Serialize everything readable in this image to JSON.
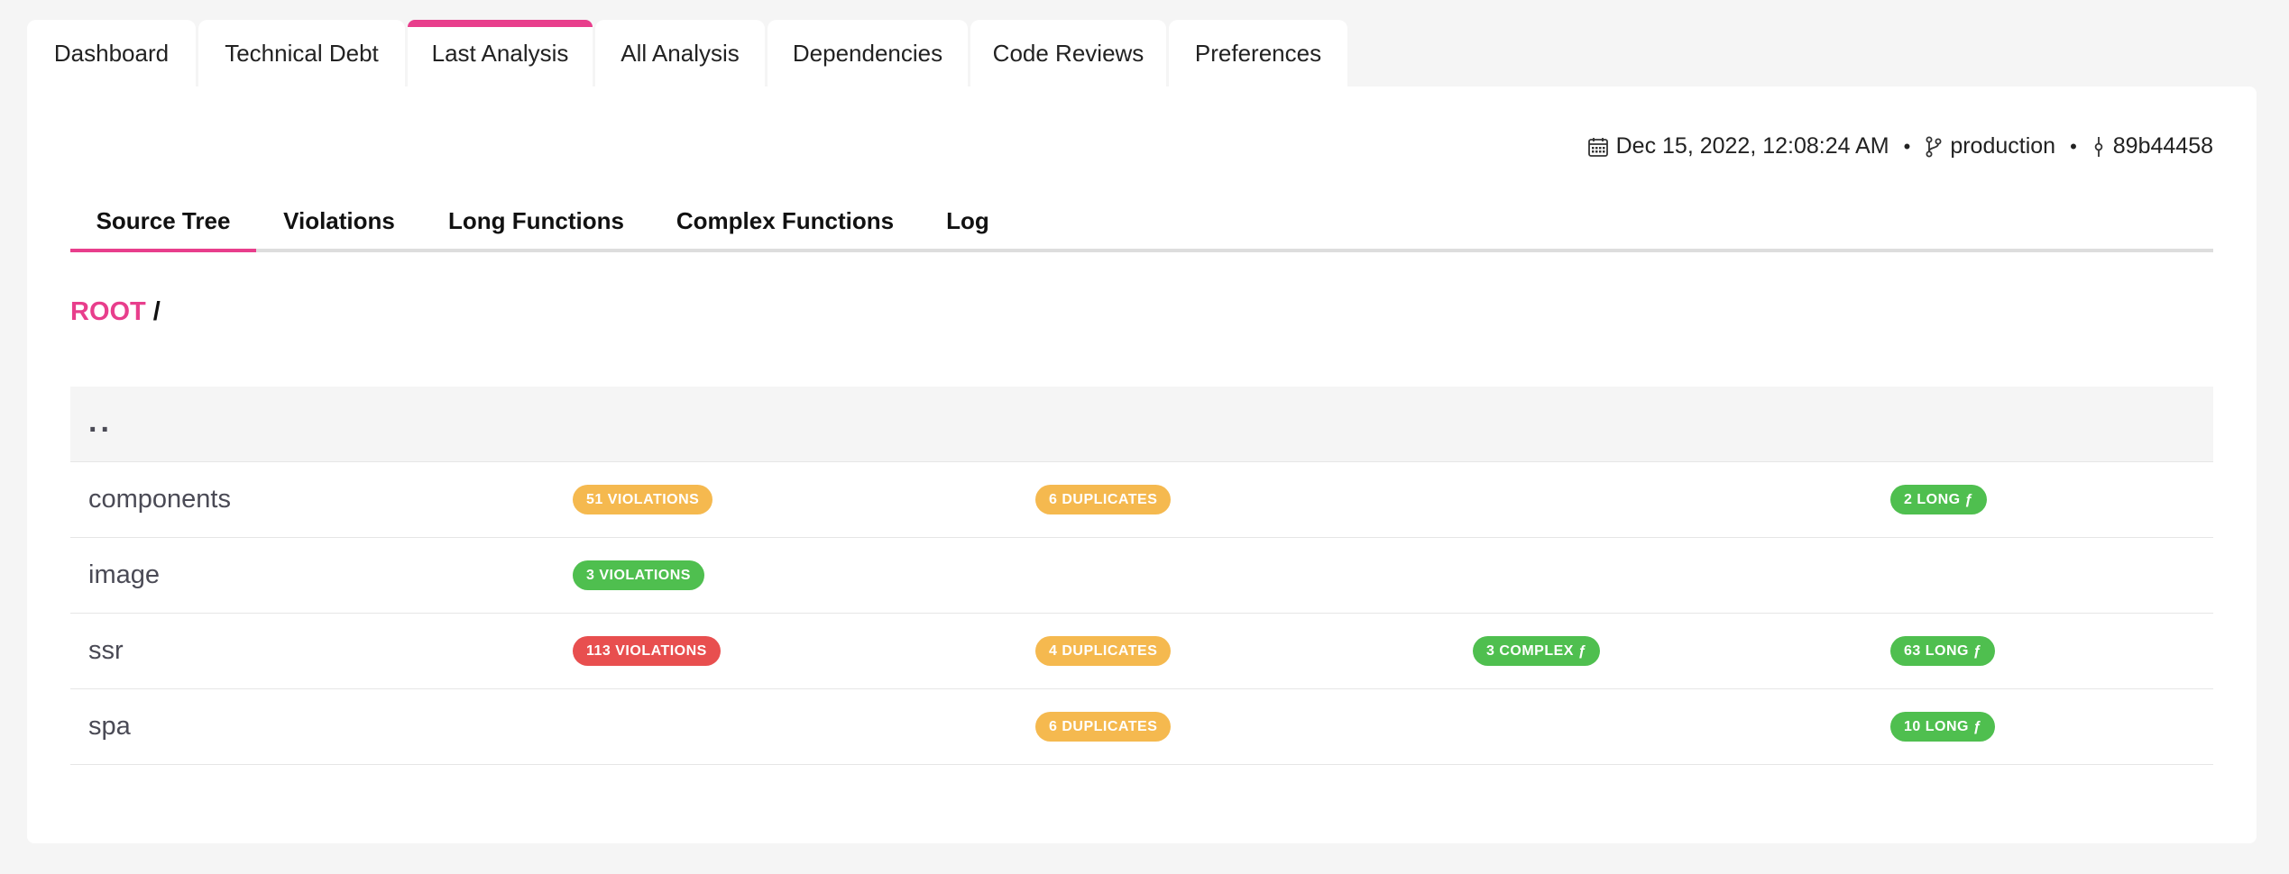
{
  "top_tabs": [
    {
      "label": "Dashboard",
      "active": false
    },
    {
      "label": "Technical Debt",
      "active": false
    },
    {
      "label": "Last Analysis",
      "active": true
    },
    {
      "label": "All Analysis",
      "active": false
    },
    {
      "label": "Dependencies",
      "active": false
    },
    {
      "label": "Code Reviews",
      "active": false
    },
    {
      "label": "Preferences",
      "active": false
    }
  ],
  "meta": {
    "date": "Dec 15, 2022, 12:08:24 AM",
    "branch": "production",
    "commit": "89b44458",
    "separator": "•"
  },
  "sub_tabs": [
    {
      "label": "Source Tree",
      "active": true
    },
    {
      "label": "Violations",
      "active": false
    },
    {
      "label": "Long Functions",
      "active": false
    },
    {
      "label": "Complex Functions",
      "active": false
    },
    {
      "label": "Log",
      "active": false
    }
  ],
  "breadcrumb": {
    "root": "ROOT",
    "separator": "/"
  },
  "tree": {
    "parent_label": "..",
    "rows": [
      {
        "name": "components",
        "violations": "51 VIOLATIONS",
        "duplicates": "6 DUPLICATES",
        "complex": "",
        "long": "2 LONG ƒ"
      },
      {
        "name": "image",
        "violations": "3 VIOLATIONS",
        "duplicates": "",
        "complex": "",
        "long": ""
      },
      {
        "name": "ssr",
        "violations": "113 VIOLATIONS",
        "duplicates": "4 DUPLICATES",
        "complex": "3 COMPLEX ƒ",
        "long": "63 LONG ƒ"
      },
      {
        "name": "spa",
        "violations": "",
        "duplicates": "6 DUPLICATES",
        "complex": "",
        "long": "10 LONG ƒ"
      }
    ]
  },
  "colors": {
    "accent": "#e83e8c",
    "badge_orange": "#f5b94f",
    "badge_green": "#4fbf4f",
    "badge_red": "#e84f4f"
  },
  "icons": {
    "date": "calendar-icon",
    "branch": "git-branch-icon",
    "commit": "git-commit-icon"
  }
}
